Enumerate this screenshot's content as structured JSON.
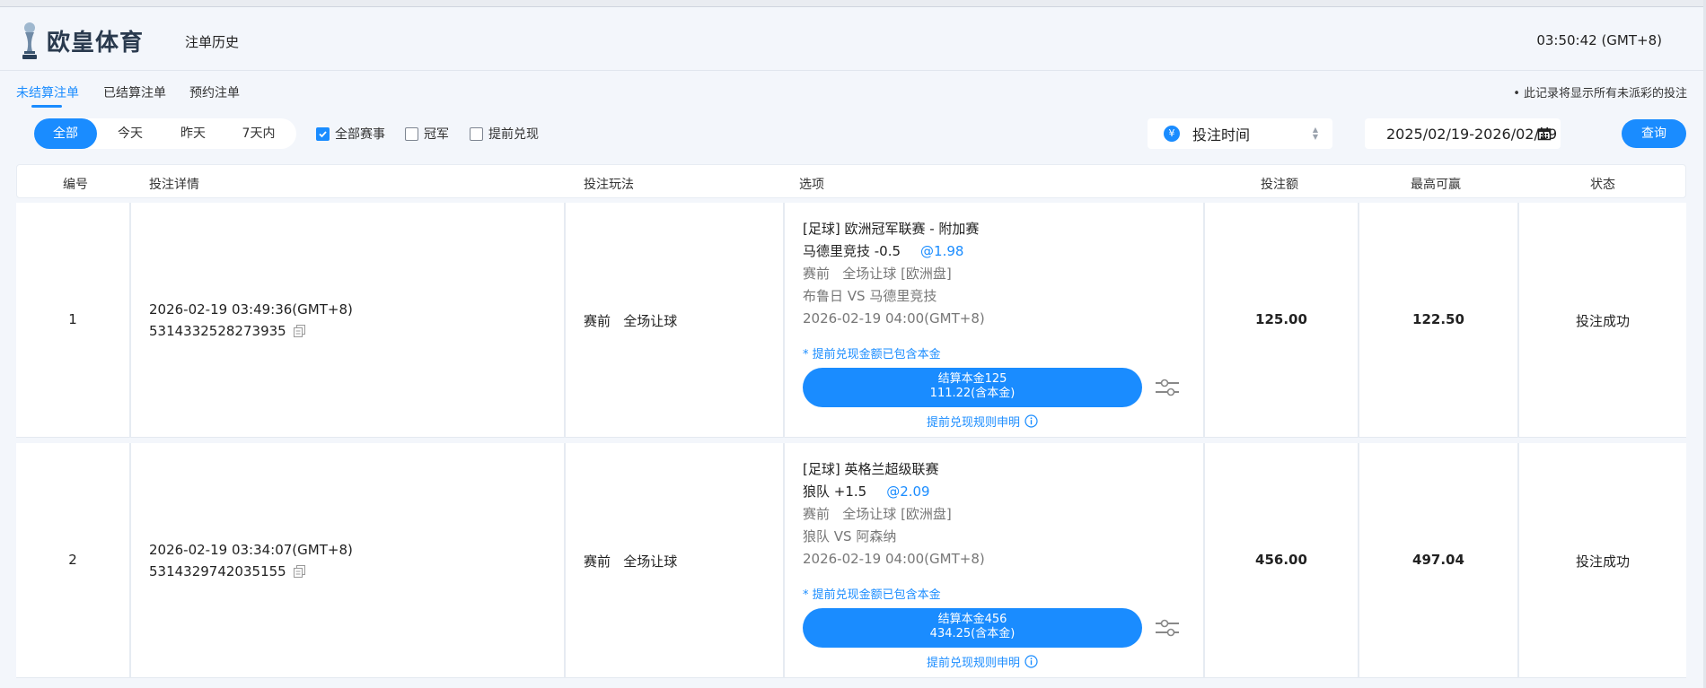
{
  "header": {
    "logo_text": "欧皇体育",
    "page_title": "注单历史",
    "clock": "03:50:42 (GMT+8)"
  },
  "tabs": [
    {
      "label": "未结算注单",
      "active": true
    },
    {
      "label": "已结算注单",
      "active": false
    },
    {
      "label": "预约注单",
      "active": false
    }
  ],
  "notice": "• 此记录将显示所有未派彩的投注",
  "filters": {
    "segments": [
      {
        "label": "全部",
        "active": true
      },
      {
        "label": "今天",
        "active": false
      },
      {
        "label": "昨天",
        "active": false
      },
      {
        "label": "7天内",
        "active": false
      }
    ],
    "checkboxes": [
      {
        "label": "全部赛事",
        "checked": true
      },
      {
        "label": "冠军",
        "checked": false
      },
      {
        "label": "提前兑现",
        "checked": false
      }
    ],
    "sort_select": "投注时间",
    "date_range": "2025/02/19-2026/02/19",
    "query_label": "查询"
  },
  "table": {
    "headers": [
      "编号",
      "投注详情",
      "投注玩法",
      "选项",
      "投注额",
      "最高可赢",
      "状态"
    ],
    "rows": [
      {
        "no": "1",
        "time": "2026-02-19 03:49:36(GMT+8)",
        "bet_id": "5314332528273935",
        "play": "赛前   全场让球",
        "league": "[足球] 欧洲冠军联赛 - 附加赛",
        "selection": "马德里竞技 -0.5",
        "odds": "@1.98",
        "market": "赛前   全场让球 [欧洲盘]",
        "match": "布鲁日 VS 马德里竞技",
        "kickoff": "2026-02-19 04:00(GMT+8)",
        "note": "* 提前兑现金额已包含本金",
        "cashout_line1": "结算本金125",
        "cashout_line2": "111.22(含本金)",
        "rule_link": "提前兑现规则申明",
        "amount": "125.00",
        "max_win": "122.50",
        "status": "投注成功"
      },
      {
        "no": "2",
        "time": "2026-02-19 03:34:07(GMT+8)",
        "bet_id": "5314329742035155",
        "play": "赛前   全场让球",
        "league": "[足球] 英格兰超级联赛",
        "selection": "狼队 +1.5",
        "odds": "@2.09",
        "market": "赛前   全场让球 [欧洲盘]",
        "match": "狼队 VS 阿森纳",
        "kickoff": "2026-02-19 04:00(GMT+8)",
        "note": "* 提前兑现金额已包含本金",
        "cashout_line1": "结算本金456",
        "cashout_line2": "434.25(含本金)",
        "rule_link": "提前兑现规则申明",
        "amount": "456.00",
        "max_win": "497.04",
        "status": "投注成功"
      }
    ]
  },
  "colors": {
    "accent": "#1a8cff",
    "background": "#f3f6fb"
  }
}
